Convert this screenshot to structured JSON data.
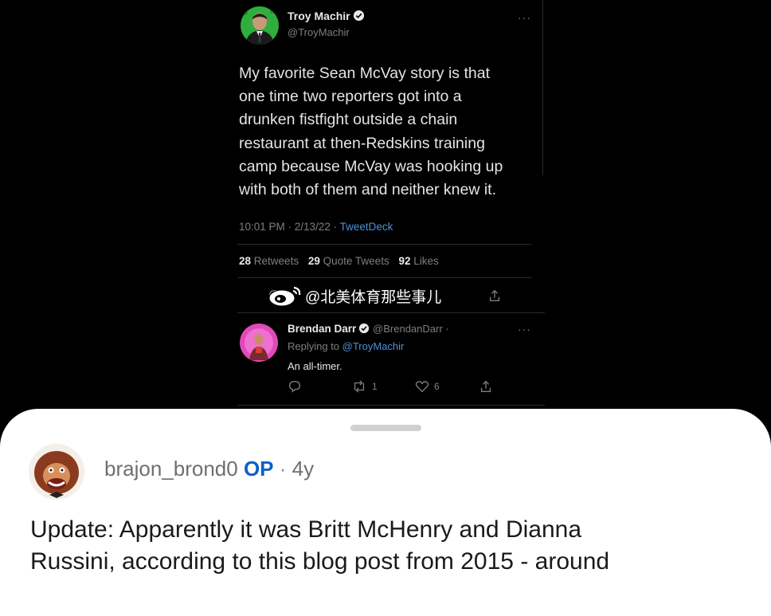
{
  "tweet": {
    "author_name": "Troy Machir",
    "author_handle": "@TroyMachir",
    "more_label": "···",
    "lines": [
      "My favorite Sean McVay story is that",
      "one time two reporters got into a",
      "drunken fistfight outside a chain",
      "restaurant at then-Redskins training",
      "camp because McVay was hooking up",
      "with both of them and neither knew it."
    ],
    "timestamp": "10:01 PM · 2/13/22 · ",
    "source": "TweetDeck",
    "retweets_count": "28",
    "retweets_label": "Retweets",
    "quote_count": "29",
    "quote_label": "Quote Tweets",
    "likes_count": "92",
    "likes_label": "Likes"
  },
  "watermark": {
    "text": "@北美体育那些事儿"
  },
  "reply": {
    "author_name": "Brendan Darr",
    "author_handle": "@BrendanDarr · ",
    "more_label": "···",
    "replying_prefix": "Replying to ",
    "replying_mention": "@TroyMachir",
    "text": "An all-timer.",
    "retweet_count": "1",
    "like_count": "6"
  },
  "comment": {
    "username": "brajon_brond0",
    "op_badge": "OP",
    "separator": "·",
    "age": "4y",
    "lines": [
      "Update: Apparently it was Britt McHenry and Dianna",
      "Russini, according to this blog post from 2015 - around"
    ]
  },
  "colors": {
    "accent_blue": "#4a90d9",
    "op_blue": "#0b60c8",
    "tweet_bg": "#000000",
    "sheet_bg": "#ffffff"
  },
  "icons": [
    "verified-icon",
    "reply-icon",
    "retweet-icon",
    "like-icon",
    "share-icon",
    "weibo-logo-icon"
  ]
}
